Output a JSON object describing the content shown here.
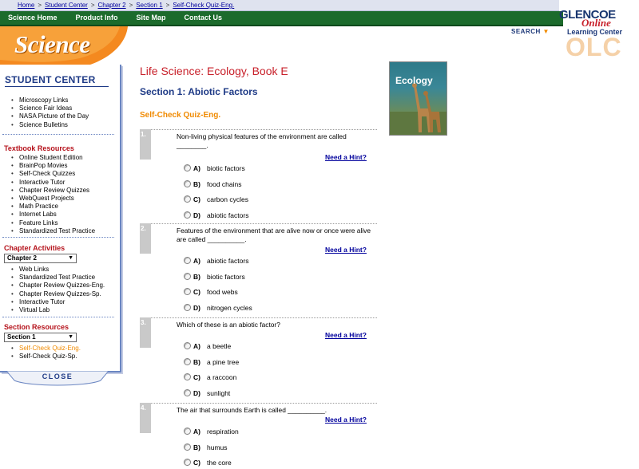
{
  "breadcrumb": [
    {
      "label": "Home"
    },
    {
      "label": "Student Center"
    },
    {
      "label": "Chapter 2"
    },
    {
      "label": "Section 1"
    },
    {
      "label": "Self-Check Quiz-Eng."
    }
  ],
  "breadcrumb_separator": ">",
  "nav": [
    "Science Home",
    "Product Info",
    "Site Map",
    "Contact Us"
  ],
  "logo": {
    "glencoe": "GLENCOE",
    "online": "Online",
    "learning_center": "Learning Center",
    "olc": "OLC",
    "science": "Science"
  },
  "search_label": "SEARCH",
  "sidebar": {
    "student_center_title": "STUDENT CENTER",
    "student_center_links": [
      "Microscopy Links",
      "Science Fair Ideas",
      "NASA Picture of the Day",
      "Science Bulletins"
    ],
    "textbook_resources_title": "Textbook Resources",
    "textbook_resources_links": [
      "Online Student Edition",
      "BrainPop Movies",
      "Self-Check Quizzes",
      "Interactive Tutor",
      "Chapter Review Quizzes",
      "WebQuest Projects",
      "Math Practice",
      "Internet Labs",
      "Feature Links",
      "Standardized Test Practice"
    ],
    "chapter_activities_title": "Chapter Activities",
    "chapter_select": "Chapter 2",
    "chapter_activities_links": [
      "Web Links",
      "Standardized Test Practice",
      "Chapter Review Quizzes-Eng.",
      "Chapter Review Quizzes-Sp.",
      "Interactive Tutor",
      "Virtual Lab"
    ],
    "section_resources_title": "Section Resources",
    "section_select": "Section 1",
    "section_resources_links": [
      "Self-Check Quiz-Eng.",
      "Self-Check Quiz-Sp."
    ],
    "section_resources_active_index": 0,
    "close_label": "CLOSE"
  },
  "content": {
    "book_title": "Life Science: Ecology, Book E",
    "section_title": "Section 1: Abiotic Factors",
    "quiz_title": "Self-Check Quiz-Eng.",
    "cover_word": "Ecology",
    "hint_label": "Need a Hint?"
  },
  "questions": [
    {
      "number": "1.",
      "text": "Non-living physical features of the environment are called ________.",
      "options": [
        {
          "letter": "A)",
          "text": "biotic factors"
        },
        {
          "letter": "B)",
          "text": "food chains"
        },
        {
          "letter": "C)",
          "text": "carbon cycles"
        },
        {
          "letter": "D)",
          "text": "abiotic factors"
        }
      ]
    },
    {
      "number": "2.",
      "text": "Features of the environment that are alive now or once were alive are called __________.",
      "options": [
        {
          "letter": "A)",
          "text": "abiotic factors"
        },
        {
          "letter": "B)",
          "text": "biotic factors"
        },
        {
          "letter": "C)",
          "text": "food webs"
        },
        {
          "letter": "D)",
          "text": "nitrogen cycles"
        }
      ]
    },
    {
      "number": "3.",
      "text": "Which of these is an abiotic factor?",
      "options": [
        {
          "letter": "A)",
          "text": "a beetle"
        },
        {
          "letter": "B)",
          "text": "a pine tree"
        },
        {
          "letter": "C)",
          "text": "a raccoon"
        },
        {
          "letter": "D)",
          "text": "sunlight"
        }
      ]
    },
    {
      "number": "4.",
      "text": "The air that surrounds Earth is called __________.",
      "options": [
        {
          "letter": "A)",
          "text": "respiration"
        },
        {
          "letter": "B)",
          "text": "humus"
        },
        {
          "letter": "C)",
          "text": "the core"
        }
      ]
    }
  ]
}
